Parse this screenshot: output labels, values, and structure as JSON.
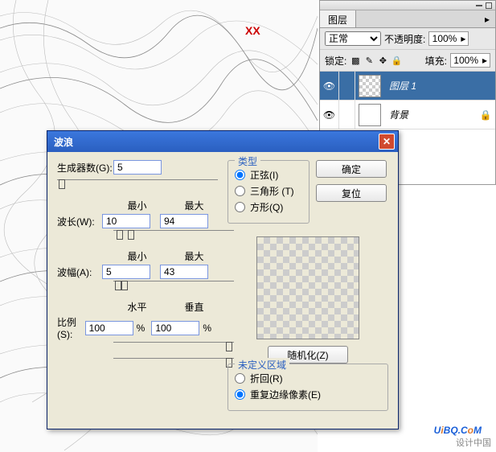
{
  "canvas": {
    "xx_mark": "XX"
  },
  "layers_panel": {
    "tab_layers": "图层",
    "blend_mode": "正常",
    "opacity_label": "不透明度:",
    "opacity_value": "100%",
    "lock_label": "锁定:",
    "fill_label": "填充:",
    "fill_value": "100%",
    "items": [
      {
        "name": "图层 1",
        "locked": false,
        "selected": true,
        "checker": true
      },
      {
        "name": "背景",
        "locked": true,
        "selected": false,
        "checker": false
      }
    ]
  },
  "dialog": {
    "title": "波浪",
    "generators_label": "生成器数(G):",
    "generators_value": "5",
    "min_label": "最小",
    "max_label": "最大",
    "wavelength_label": "波长(W):",
    "wavelength_min": "10",
    "wavelength_max": "94",
    "amplitude_label": "波幅(A):",
    "amplitude_min": "5",
    "amplitude_max": "43",
    "horiz_label": "水平",
    "vert_label": "垂直",
    "scale_label": "比例(S):",
    "scale_h": "100",
    "scale_v": "100",
    "percent": "%",
    "type_group": "类型",
    "type_sine": "正弦(I)",
    "type_triangle": "三角形 (T)",
    "type_square": "方形(Q)",
    "ok_btn": "确定",
    "reset_btn": "复位",
    "randomize_btn": "随机化(Z)",
    "undefined_group": "未定义区域",
    "wrap_label": "折回(R)",
    "repeat_edge_label": "重复边缘像素(E)"
  },
  "watermark": {
    "pre": "U",
    "i": "i",
    "bq": "BQ.C",
    "o": "o",
    "m": "M"
  },
  "watermark2": "设计中国"
}
